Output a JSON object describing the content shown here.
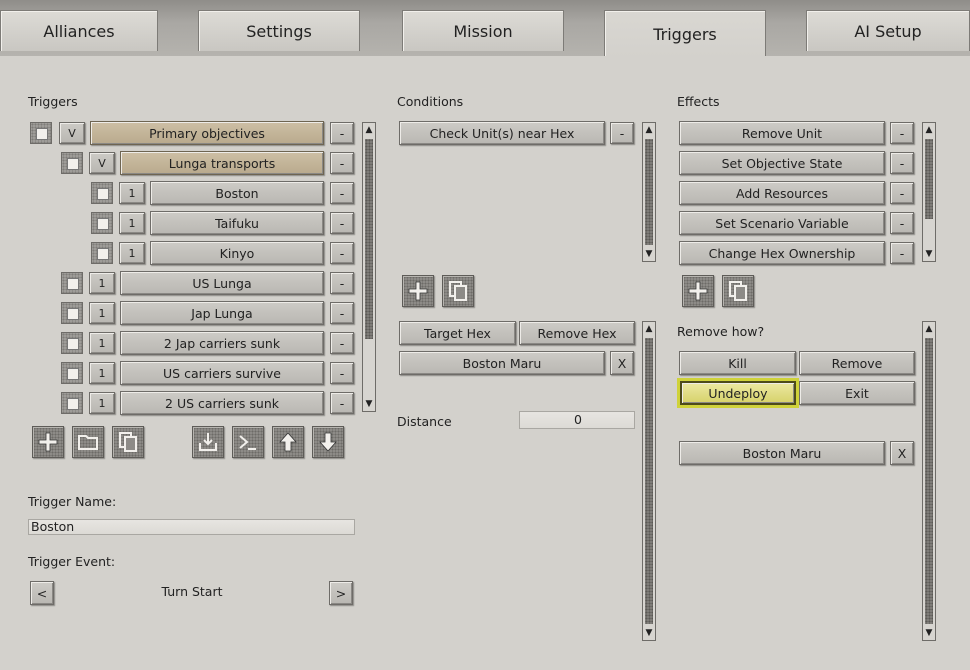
{
  "tabs": [
    "Alliances",
    "Settings",
    "Mission",
    "Triggers",
    "AI Setup"
  ],
  "triggers": {
    "label": "Triggers",
    "rows": [
      {
        "flag": "V",
        "name": "Primary objectives"
      },
      {
        "flag": "V",
        "name": "Lunga transports"
      },
      {
        "flag": "1",
        "name": "Boston"
      },
      {
        "flag": "1",
        "name": "Taifuku"
      },
      {
        "flag": "1",
        "name": "Kinyo"
      },
      {
        "flag": "1",
        "name": "US Lunga"
      },
      {
        "flag": "1",
        "name": "Jap Lunga"
      },
      {
        "flag": "1",
        "name": "2 Jap carriers sunk"
      },
      {
        "flag": "1",
        "name": "US carriers survive"
      },
      {
        "flag": "1",
        "name": "2 US carriers sunk"
      }
    ],
    "remove_label": "-",
    "name_label": "Trigger Name:",
    "name_value": "Boston",
    "event_label": "Trigger Event:",
    "event_value": "Turn Start",
    "prev": "<",
    "next": ">"
  },
  "conditions": {
    "label": "Conditions",
    "items": [
      "Check Unit(s) near Hex"
    ],
    "target_hex": "Target Hex",
    "remove_hex": "Remove Hex",
    "unit": "Boston Maru",
    "clear": "X",
    "distance_label": "Distance",
    "distance_value": "0"
  },
  "effects": {
    "label": "Effects",
    "items": [
      "Remove Unit",
      "Set Objective State",
      "Add Resources",
      "Set Scenario Variable",
      "Change Hex Ownership"
    ],
    "remove_how_label": "Remove how?",
    "options": [
      "Kill",
      "Remove",
      "Undeploy",
      "Exit"
    ],
    "selected": "Undeploy",
    "unit": "Boston Maru",
    "clear": "X"
  },
  "colors": {
    "highlight": "#cfd23a",
    "gold_button": "#c4b598"
  }
}
